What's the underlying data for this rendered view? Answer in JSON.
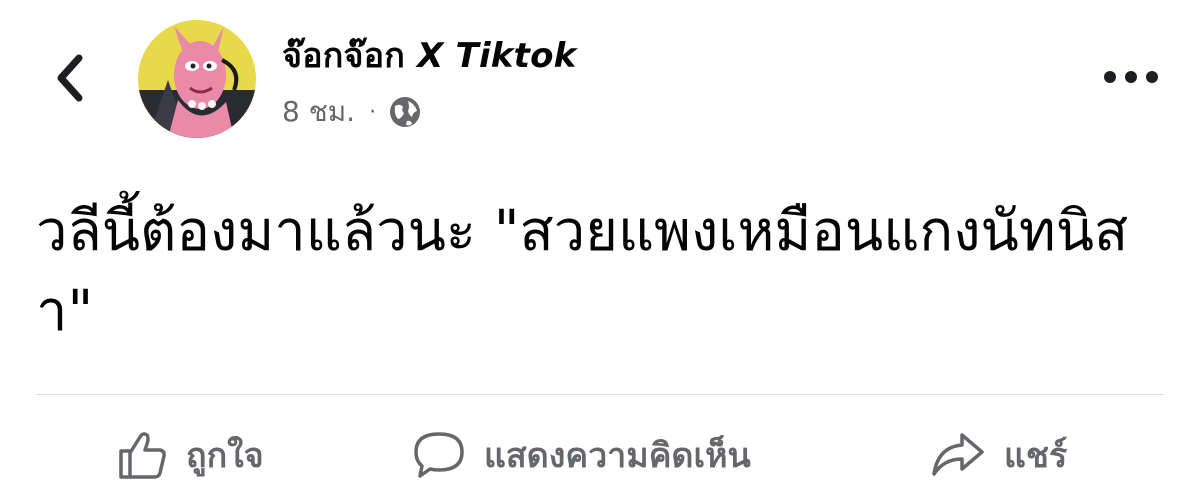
{
  "post": {
    "author_thai": "จ๊อกจ๊อก",
    "author_en": "X Tiktok",
    "time": "8 ชม.",
    "separator": "·",
    "privacy_icon": "globe-icon",
    "text": "วลีนี้ต้องมาแล้วนะ \"สวยแพงเหมือนแกงนัทนิสา\""
  },
  "actions": {
    "like": "ถูกใจ",
    "comment": "แสดงความคิดเห็น",
    "share": "แชร์"
  },
  "colors": {
    "text": "#050505",
    "secondary": "#65676b",
    "divider": "#dadde1",
    "avatar_bg": "#e8d94a",
    "avatar_figure": "#e88aa8"
  }
}
